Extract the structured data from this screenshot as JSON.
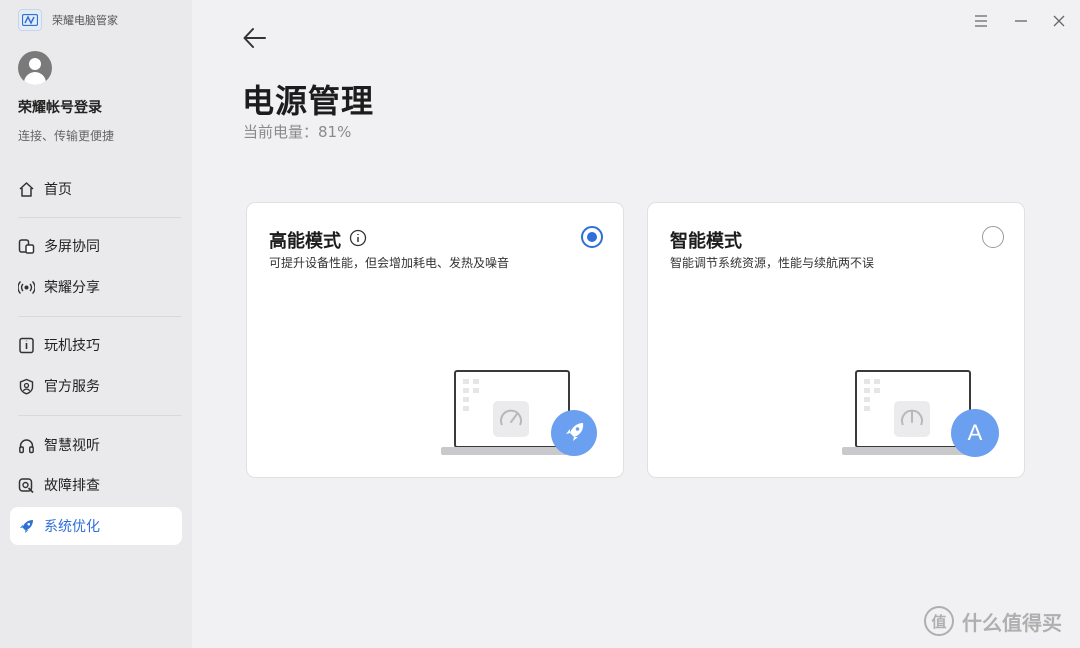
{
  "window": {
    "app_title": "荣耀电脑管家",
    "controls": [
      "menu-icon",
      "minimize-icon",
      "close-icon"
    ]
  },
  "account": {
    "name": "荣耀帐号登录",
    "subtitle": "连接、传输更便捷"
  },
  "sidebar": {
    "items": [
      {
        "label": "首页",
        "icon": "home-icon"
      },
      {
        "label": "多屏协同",
        "icon": "multiscreen-icon"
      },
      {
        "label": "荣耀分享",
        "icon": "share-broadcast-icon"
      },
      {
        "label": "玩机技巧",
        "icon": "tips-icon"
      },
      {
        "label": "官方服务",
        "icon": "service-icon"
      },
      {
        "label": "智慧视听",
        "icon": "headphones-icon"
      },
      {
        "label": "故障排查",
        "icon": "troubleshoot-icon"
      },
      {
        "label": "系统优化",
        "icon": "rocket-icon",
        "active": true
      }
    ]
  },
  "main": {
    "page_title": "电源管理",
    "battery_label": "当前电量：",
    "battery_value": "81%",
    "modes": [
      {
        "title": "高能模式",
        "description": "可提升设备性能，但会增加耗电、发热及噪音",
        "selected": true,
        "has_info_icon": true,
        "badge_icon": "rocket-icon"
      },
      {
        "title": "智能模式",
        "description": "智能调节系统资源，性能与续航两不误",
        "selected": false,
        "has_info_icon": false,
        "badge_icon": "auto-a-icon",
        "badge_text": "A"
      }
    ]
  },
  "watermark": {
    "badge": "值",
    "text": "什么值得买"
  },
  "colors": {
    "accent": "#2f6fd8",
    "badge_blue": "#6b9ff0",
    "sidebar_bg": "#eaeaec",
    "main_bg": "#f1f1f3"
  }
}
